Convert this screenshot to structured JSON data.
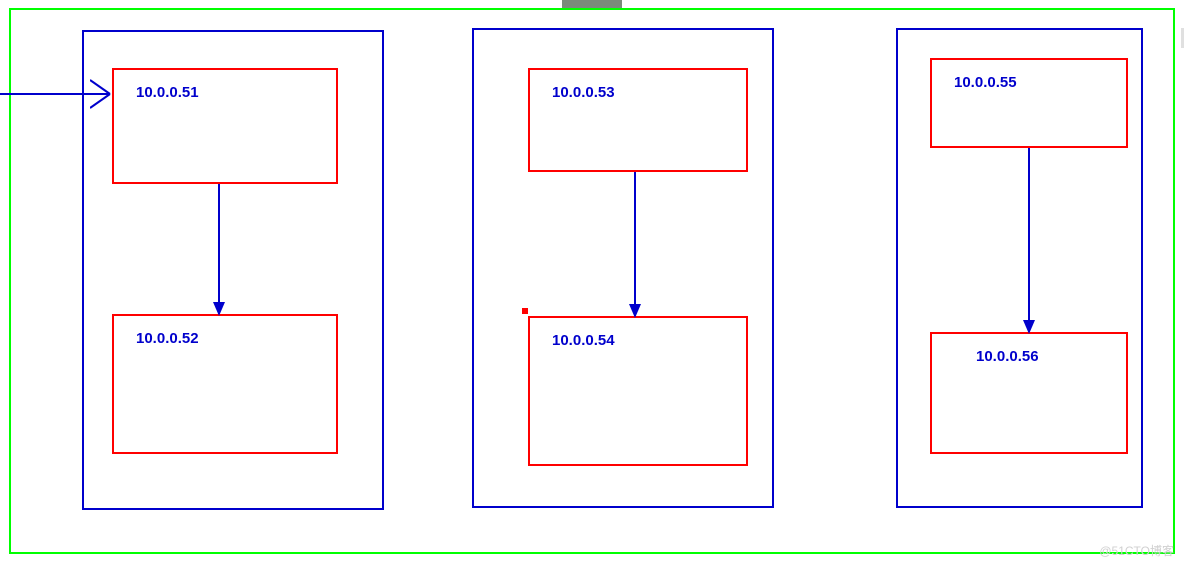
{
  "top_tab_label": "",
  "watermark": "@51CTO博客",
  "groups": [
    {
      "nodes": [
        {
          "ip": "10.0.0.51"
        },
        {
          "ip": "10.0.0.52"
        }
      ]
    },
    {
      "nodes": [
        {
          "ip": "10.0.0.53"
        },
        {
          "ip": "10.0.0.54"
        }
      ]
    },
    {
      "nodes": [
        {
          "ip": "10.0.0.55"
        },
        {
          "ip": "10.0.0.56"
        }
      ]
    }
  ],
  "colors": {
    "outer_border": "#00ff00",
    "group_border": "#0000cc",
    "node_border": "#ff0000",
    "text": "#0000cc",
    "arrow": "#0000cc"
  }
}
